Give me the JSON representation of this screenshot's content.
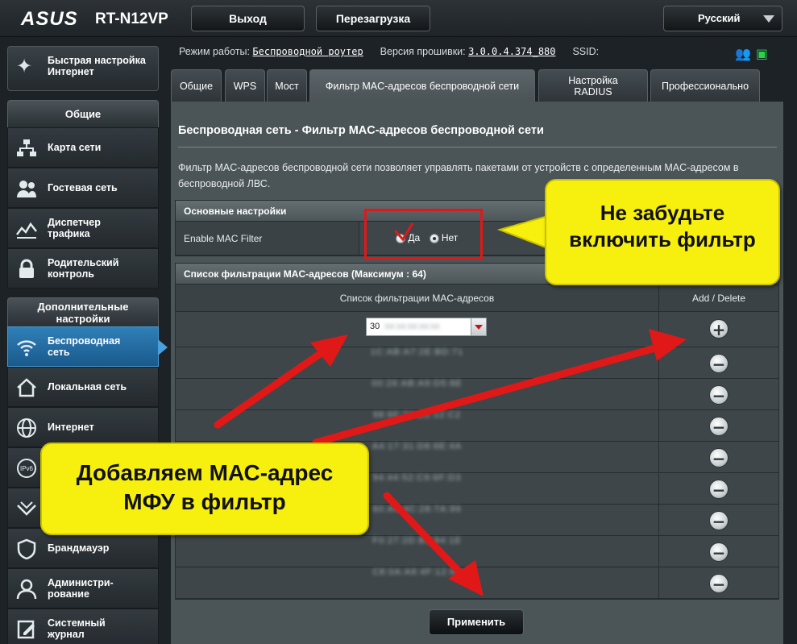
{
  "header": {
    "logo": "ASUS",
    "model": "RT-N12VP",
    "logout_label": "Выход",
    "reboot_label": "Перезагрузка",
    "language": "Русский"
  },
  "sidebar": {
    "quick_setup": "Быстрая настройка Интернет",
    "general_title": "Общие",
    "general_items": [
      {
        "label": "Карта сети",
        "icon": "network-map-icon"
      },
      {
        "label": "Гостевая сеть",
        "icon": "guest-network-icon"
      },
      {
        "label": "Диспетчер трафика",
        "icon": "traffic-manager-icon"
      },
      {
        "label": "Родительский контроль",
        "icon": "lock-icon"
      }
    ],
    "advanced_title": "Дополнительные настройки",
    "advanced_items": [
      {
        "label": "Беспроводная сеть",
        "icon": "wifi-icon",
        "active": true
      },
      {
        "label": "Локальная сеть",
        "icon": "home-icon"
      },
      {
        "label": "Интернет",
        "icon": "globe-icon"
      },
      {
        "label": "",
        "icon": "ipv6-icon"
      },
      {
        "label": "",
        "icon": "vpn-icon"
      },
      {
        "label": "Брандмауэр",
        "icon": "firewall-icon"
      },
      {
        "label": "Администри-рование",
        "icon": "admin-icon"
      },
      {
        "label": "Системный журнал",
        "icon": "syslog-icon"
      }
    ]
  },
  "status": {
    "mode_label": "Режим работы:",
    "mode_value": "Беспроводной роутер",
    "firmware_label": "Версия прошивки:",
    "firmware_value": "3.0.0.4.374_880",
    "ssid_label": "SSID:"
  },
  "tabs": [
    {
      "label": "Общие"
    },
    {
      "label": "WPS"
    },
    {
      "label": "Мост"
    },
    {
      "label": "Фильтр MAC-адресов беспроводной сети",
      "active": true
    },
    {
      "label": "Настройка RADIUS"
    },
    {
      "label": "Профессионально"
    }
  ],
  "main": {
    "title": "Беспроводная сеть - Фильтр MAC-адресов беспроводной сети",
    "description": "Фильтр MAC-адресов беспроводной сети позволяет управлять пакетами от устройств с определенным MAC-адресом в беспроводной ЛВС.",
    "basic_section": "Основные настройки",
    "enable_label": "Enable MAC Filter",
    "radio_yes": "Да",
    "radio_no": "Нет",
    "enable_selected": "Нет",
    "list_section": "Список фильтрации MAC-адресов (Максимум : 64)",
    "col_list": "Список фильтрации MAC-адресов",
    "col_action": "Add / Delete",
    "input_value": "30",
    "entries": [
      "1C:AB:A7:2E:BD:71",
      "00:26:AB:A9:D5:8E",
      "98:6F:74:B1:12:C2",
      "A4:17:31:D8:6E:4A",
      "94:44:52:C9:6F:D3",
      "60:A4:4C:28:7A:99",
      "F0:27:2D:B3:84:1E",
      "C8:0A:A9:4F:12:60"
    ],
    "apply_label": "Применить"
  },
  "annotations": {
    "callout_top": "Не забудьте включить фильтр",
    "callout_bottom": "Добавляем МАС-адрес МФУ в фильтр",
    "color": "#f7f00e",
    "arrow_color": "#e01818"
  }
}
